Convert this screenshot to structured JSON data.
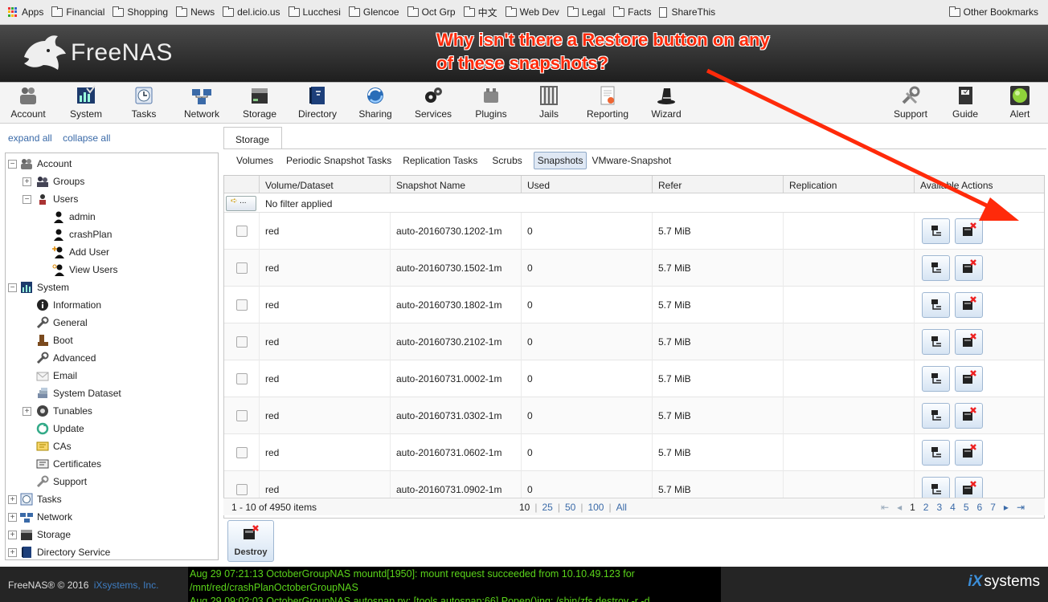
{
  "bookmarks": {
    "apps": "Apps",
    "items": [
      "Financial",
      "Shopping",
      "News",
      "del.icio.us",
      "Lucchesi",
      "Glencoe",
      "Oct Grp",
      "中文",
      "Web Dev",
      "Legal",
      "Facts"
    ],
    "sharethis": "ShareThis",
    "other": "Other Bookmarks"
  },
  "header": {
    "logo_text": "FreeNAS",
    "annotation": "Why isn't there a Restore button on any of these snapshots?"
  },
  "toolbar": {
    "account": "Account",
    "system": "System",
    "tasks": "Tasks",
    "network": "Network",
    "storage": "Storage",
    "directory": "Directory",
    "sharing": "Sharing",
    "services": "Services",
    "plugins": "Plugins",
    "jails": "Jails",
    "reporting": "Reporting",
    "wizard": "Wizard",
    "support": "Support",
    "guide": "Guide",
    "alert": "Alert"
  },
  "tree": {
    "expand_all": "expand all",
    "collapse_all": "collapse all",
    "account": "Account",
    "groups": "Groups",
    "users": "Users",
    "admin": "admin",
    "crashplan": "crashPlan",
    "add_user": "Add User",
    "view_users": "View Users",
    "system": "System",
    "information": "Information",
    "general": "General",
    "boot": "Boot",
    "advanced": "Advanced",
    "email": "Email",
    "system_dataset": "System Dataset",
    "tunables": "Tunables",
    "update": "Update",
    "cas": "CAs",
    "certificates": "Certificates",
    "support": "Support",
    "tasks": "Tasks",
    "network": "Network",
    "storage": "Storage",
    "directory_service": "Directory Service"
  },
  "main": {
    "tab": "Storage",
    "subtabs": {
      "volumes": "Volumes",
      "periodic": "Periodic Snapshot Tasks",
      "replication": "Replication Tasks",
      "scrubs": "Scrubs",
      "snapshots": "Snapshots",
      "vmware": "VMware-Snapshot"
    },
    "columns": {
      "volume": "Volume/Dataset",
      "name": "Snapshot Name",
      "used": "Used",
      "refer": "Refer",
      "replication": "Replication",
      "actions": "Available Actions"
    },
    "filter_btn": "...",
    "filter_text": "No filter applied",
    "rows": [
      {
        "volume": "red",
        "name": "auto-20160730.1202-1m",
        "used": "0",
        "refer": "5.7 MiB",
        "replication": ""
      },
      {
        "volume": "red",
        "name": "auto-20160730.1502-1m",
        "used": "0",
        "refer": "5.7 MiB",
        "replication": ""
      },
      {
        "volume": "red",
        "name": "auto-20160730.1802-1m",
        "used": "0",
        "refer": "5.7 MiB",
        "replication": ""
      },
      {
        "volume": "red",
        "name": "auto-20160730.2102-1m",
        "used": "0",
        "refer": "5.7 MiB",
        "replication": ""
      },
      {
        "volume": "red",
        "name": "auto-20160731.0002-1m",
        "used": "0",
        "refer": "5.7 MiB",
        "replication": ""
      },
      {
        "volume": "red",
        "name": "auto-20160731.0302-1m",
        "used": "0",
        "refer": "5.7 MiB",
        "replication": ""
      },
      {
        "volume": "red",
        "name": "auto-20160731.0602-1m",
        "used": "0",
        "refer": "5.7 MiB",
        "replication": ""
      },
      {
        "volume": "red",
        "name": "auto-20160731.0902-1m",
        "used": "0",
        "refer": "5.7 MiB",
        "replication": ""
      }
    ],
    "pager": {
      "count": "1 - 10 of 4950 items",
      "sizes": [
        "10",
        "|",
        "25",
        "|",
        "50",
        "|",
        "100",
        "|",
        "All"
      ],
      "pages": [
        "1",
        "2",
        "3",
        "4",
        "5",
        "6",
        "7"
      ]
    },
    "destroy": "Destroy"
  },
  "footer": {
    "copyright": "FreeNAS® © 2016",
    "company": "iXsystems, Inc.",
    "console": [
      "Aug 29 07:21:13 OctoberGroupNAS mountd[1950]: mount request succeeded from 10.10.49.123 for",
      "/mnt/red/crashPlanOctoberGroupNAS",
      "Aug 29 09:02:03 OctoberGroupNAS autosnap.py: [tools.autosnap:66] Popen()ing: /sbin/zfs destroy -r -d"
    ],
    "brand_ix": "iX",
    "brand_systems": "systems"
  },
  "colors": {
    "annotation": "#ff2a0a",
    "console_text": "#5ad31a",
    "link": "#3a6aa8"
  }
}
